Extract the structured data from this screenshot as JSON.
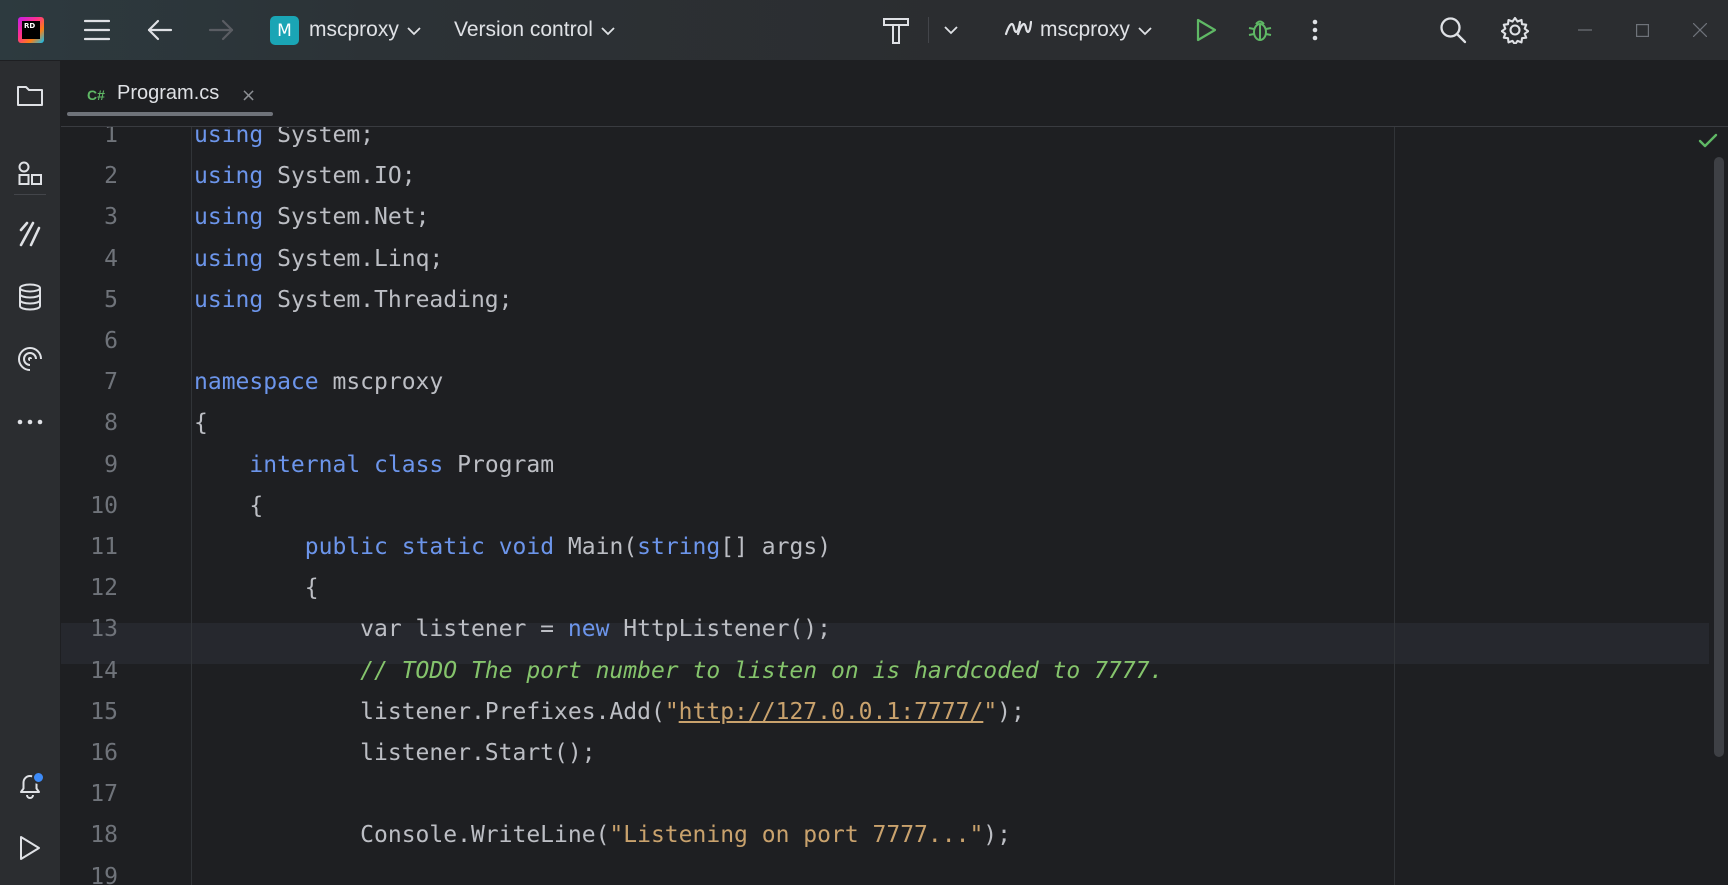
{
  "titlebar": {
    "logo_text": "RD",
    "project_badge": "M",
    "project_name": "mscproxy",
    "vcs_label": "Version control",
    "run_config": "mscproxy"
  },
  "tabs": [
    {
      "lang": "C#",
      "name": "Program.cs",
      "close": "×"
    }
  ],
  "editor": {
    "lines": [
      {
        "n": "1",
        "code": "<span class=\"kw\">using</span> System;"
      },
      {
        "n": "2",
        "code": "<span class=\"kw\">using</span> System.IO;"
      },
      {
        "n": "3",
        "code": "<span class=\"kw\">using</span> System.Net;"
      },
      {
        "n": "4",
        "code": "<span class=\"kw\">using</span> System.Linq;"
      },
      {
        "n": "5",
        "code": "<span class=\"kw\">using</span> System.Threading;"
      },
      {
        "n": "6",
        "code": ""
      },
      {
        "n": "7",
        "code": "<span class=\"kw\">namespace</span> mscproxy"
      },
      {
        "n": "8",
        "code": "{"
      },
      {
        "n": "9",
        "code": "    <span class=\"kw\">internal</span> <span class=\"kw\">class</span> Program"
      },
      {
        "n": "10",
        "code": "    {"
      },
      {
        "n": "11",
        "code": "        <span class=\"kw\">public</span> <span class=\"kw\">static</span> <span class=\"kw\">void</span> Main(<span class=\"kw\">string</span>[] args)"
      },
      {
        "n": "12",
        "code": "        {"
      },
      {
        "n": "13",
        "code": "            var listener = <span class=\"kw\">new</span> HttpListener();"
      },
      {
        "n": "14",
        "code": "            <span class=\"cm\">// TODO The port number to listen on is hardcoded to 7777.</span>"
      },
      {
        "n": "15",
        "code": "            listener.Prefixes.Add(<span class=\"str\">\"</span><span class=\"url\">http://127.0.0.1:7777/</span><span class=\"str\">\"</span>);"
      },
      {
        "n": "16",
        "code": "            listener.Start();"
      },
      {
        "n": "17",
        "code": ""
      },
      {
        "n": "18",
        "code": "            Console.WriteLine(<span class=\"str\">\"Listening on port 7777...\"</span>);"
      },
      {
        "n": "19",
        "code": ""
      }
    ]
  }
}
